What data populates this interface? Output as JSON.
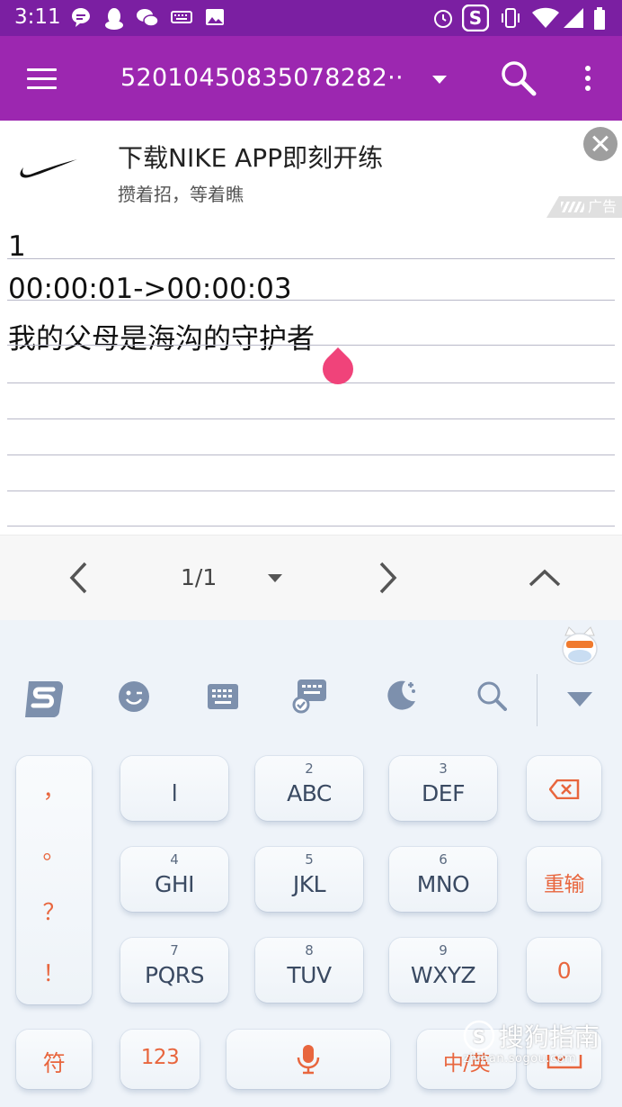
{
  "status_bar": {
    "time": "3:11",
    "left_icons": [
      "chat-bubble-icon",
      "qq-icon",
      "wechat-icon",
      "keyboard-icon",
      "image-icon"
    ],
    "right_icons": [
      "alarm-icon",
      "sogou-s-icon",
      "vibrate-icon",
      "wifi-icon",
      "signal-icon",
      "battery-icon"
    ]
  },
  "app_bar": {
    "title": "52010450835078282··",
    "background": "#9c27b0"
  },
  "ad": {
    "title": "下载NIKE APP即刻开练",
    "subtitle": "攒着招，等着瞧",
    "badge": "广告",
    "logo": "nike-swoosh-icon"
  },
  "editor": {
    "lines": [
      "1",
      "00:00:01->00:00:03",
      "我的父母是海沟的守护者"
    ]
  },
  "pager": {
    "page_text": "1/1"
  },
  "keyboard": {
    "toolbar_icons": [
      "sogou-logo-icon",
      "emoji-icon",
      "keyboard-icon",
      "game-keyboard-icon",
      "night-mode-icon",
      "search-icon",
      "collapse-icon"
    ],
    "punctuation": [
      "，",
      "。",
      "？",
      "！"
    ],
    "keys": [
      {
        "num": "",
        "label": "l"
      },
      {
        "num": "2",
        "label": "ABC"
      },
      {
        "num": "3",
        "label": "DEF"
      },
      {
        "num": "4",
        "label": "GHI"
      },
      {
        "num": "5",
        "label": "JKL"
      },
      {
        "num": "6",
        "label": "MNO"
      },
      {
        "num": "7",
        "label": "PQRS"
      },
      {
        "num": "8",
        "label": "TUV"
      },
      {
        "num": "9",
        "label": "WXYZ"
      }
    ],
    "reinput": "重输",
    "zero": "0",
    "symbols": "符",
    "numbers": "123",
    "lang": "中/英",
    "accent_color": "#e8663e"
  },
  "watermark": {
    "text": "搜狗指南",
    "url": "zhinan.sogou.com"
  }
}
